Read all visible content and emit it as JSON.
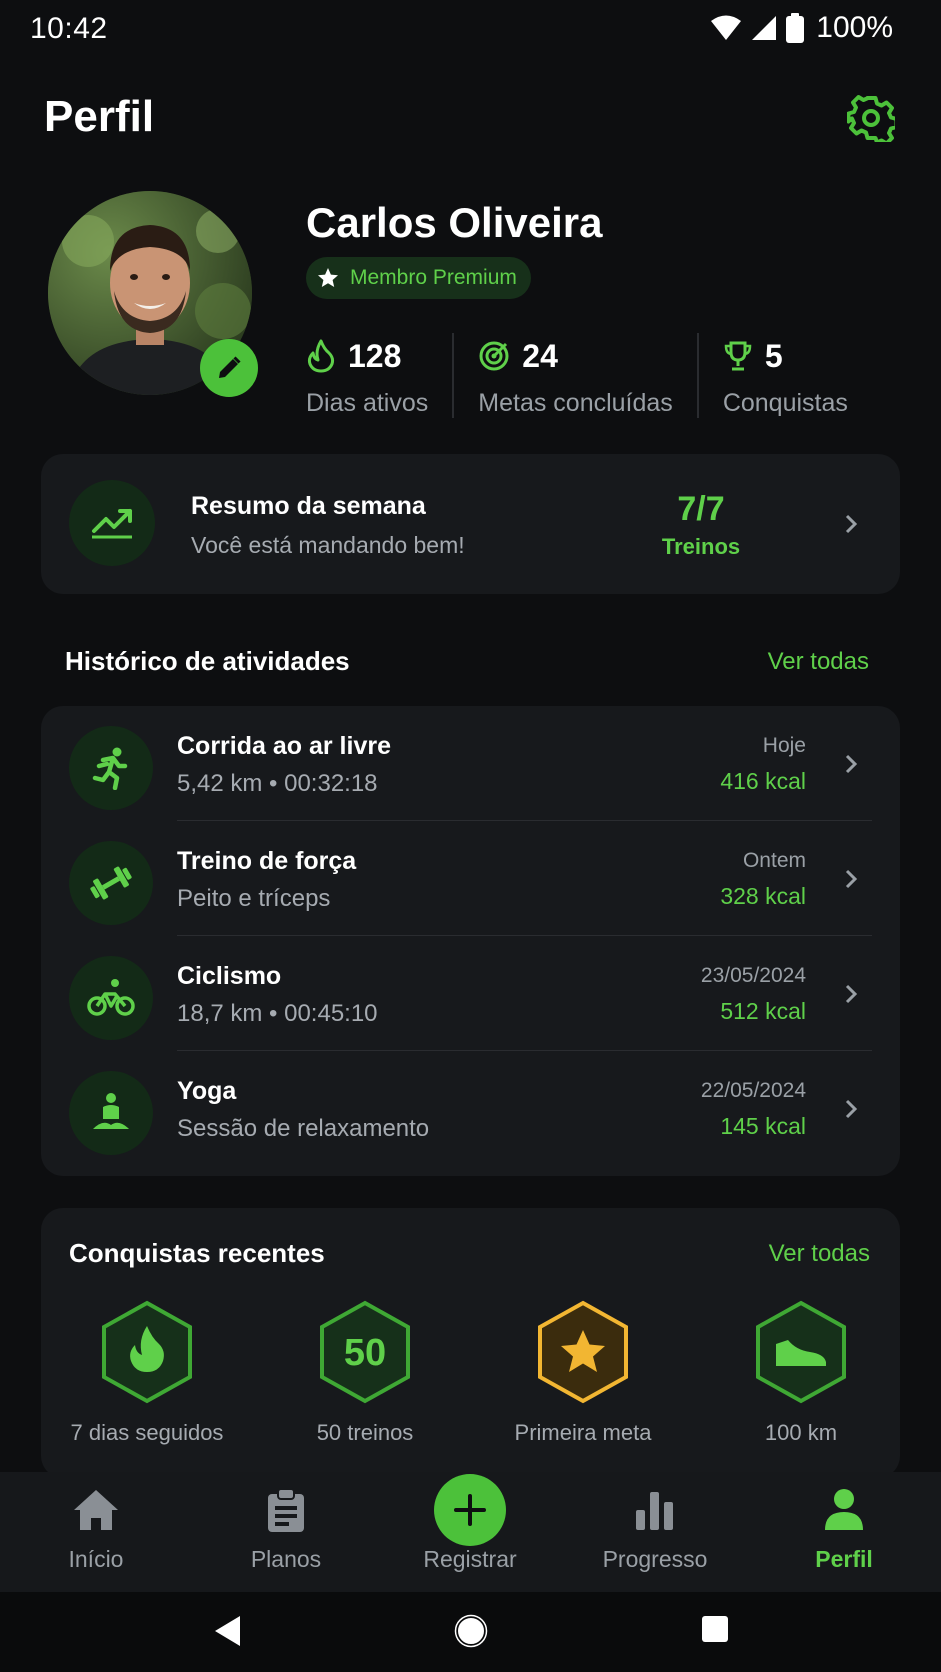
{
  "status_bar": {
    "time": "10:42",
    "battery": "100%"
  },
  "header": {
    "title": "Perfil",
    "settings_icon": "gear-icon"
  },
  "profile": {
    "name": "Carlos Oliveira",
    "badge": "Membro Premium",
    "stats": [
      {
        "icon": "flame-icon",
        "value": "128",
        "label": "Dias ativos"
      },
      {
        "icon": "target-icon",
        "value": "24",
        "label": "Metas concluídas"
      },
      {
        "icon": "trophy-icon",
        "value": "5",
        "label": "Conquistas"
      }
    ]
  },
  "week_summary": {
    "title": "Resumo da semana",
    "subtitle": "Você está mandando bem!",
    "value": "7/7",
    "value_label": "Treinos"
  },
  "activity_history": {
    "title": "Histórico de atividades",
    "see_all": "Ver todas",
    "items": [
      {
        "icon": "running-icon",
        "name": "Corrida ao ar livre",
        "detail": "5,42 km • 00:32:18",
        "date": "Hoje",
        "kcal": "416 kcal"
      },
      {
        "icon": "dumbbell-icon",
        "name": "Treino de força",
        "detail": "Peito e tríceps",
        "date": "Ontem",
        "kcal": "328 kcal"
      },
      {
        "icon": "bicycle-icon",
        "name": "Ciclismo",
        "detail": "18,7 km • 00:45:10",
        "date": "23/05/2024",
        "kcal": "512 kcal"
      },
      {
        "icon": "yoga-icon",
        "name": "Yoga",
        "detail": "Sessão de relaxamento",
        "date": "22/05/2024",
        "kcal": "145 kcal"
      }
    ]
  },
  "achievements": {
    "title": "Conquistas recentes",
    "see_all": "Ver todas",
    "items": [
      {
        "icon": "flame-badge-icon",
        "label": "7 dias seguidos"
      },
      {
        "icon": "number-badge-icon",
        "badge_text": "50",
        "label": "50 treinos"
      },
      {
        "icon": "star-badge-icon",
        "label": "Primeira meta"
      },
      {
        "icon": "shoe-badge-icon",
        "label": "100 km"
      }
    ]
  },
  "bottom_nav": {
    "items": [
      {
        "icon": "home-icon",
        "label": "Início"
      },
      {
        "icon": "clipboard-icon",
        "label": "Planos"
      },
      {
        "icon": "plus-icon",
        "label": "Registrar"
      },
      {
        "icon": "bar-chart-icon",
        "label": "Progresso"
      },
      {
        "icon": "person-icon",
        "label": "Perfil",
        "active": true
      }
    ]
  },
  "colors": {
    "accent": "#5fd04a",
    "accent_strong": "#4cc13a",
    "background": "#0d0e10",
    "card": "#17191c",
    "gold": "#f2b632"
  }
}
